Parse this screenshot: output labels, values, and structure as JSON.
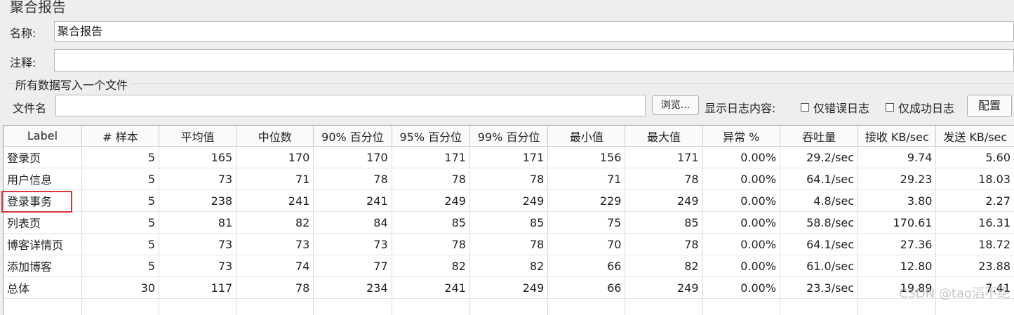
{
  "panel": {
    "title": "聚合报告"
  },
  "name_field": {
    "label": "名称:",
    "value": "聚合报告"
  },
  "comment_field": {
    "label": "注释:",
    "value": ""
  },
  "file_group": {
    "title": "所有数据写入一个文件",
    "file_label": "文件名",
    "file_value": "",
    "browse_label": "浏览...",
    "log_label": "显示日志内容:",
    "errors_only_label": "仅错误日志",
    "success_only_label": "仅成功日志",
    "configure_label": "配置"
  },
  "table": {
    "columns": [
      "Label",
      "# 样本",
      "平均值",
      "中位数",
      "90% 百分位",
      "95% 百分位",
      "99% 百分位",
      "最小值",
      "最大值",
      "异常 %",
      "吞吐量",
      "接收 KB/sec",
      "发送 KB/sec"
    ],
    "rows": [
      [
        "登录页",
        "5",
        "165",
        "170",
        "170",
        "171",
        "171",
        "156",
        "171",
        "0.00%",
        "29.2/sec",
        "9.74",
        "5.60"
      ],
      [
        "用户信息",
        "5",
        "73",
        "71",
        "78",
        "78",
        "78",
        "71",
        "78",
        "0.00%",
        "64.1/sec",
        "29.23",
        "18.03"
      ],
      [
        "登录事务",
        "5",
        "238",
        "241",
        "241",
        "249",
        "249",
        "229",
        "249",
        "0.00%",
        "4.8/sec",
        "3.80",
        "2.27"
      ],
      [
        "列表页",
        "5",
        "81",
        "82",
        "84",
        "85",
        "85",
        "75",
        "85",
        "0.00%",
        "58.8/sec",
        "170.61",
        "16.31"
      ],
      [
        "博客详情页",
        "5",
        "73",
        "73",
        "73",
        "78",
        "78",
        "70",
        "78",
        "0.00%",
        "64.1/sec",
        "27.36",
        "18.72"
      ],
      [
        "添加博客",
        "5",
        "73",
        "74",
        "77",
        "82",
        "82",
        "66",
        "82",
        "0.00%",
        "61.0/sec",
        "12.80",
        "23.88"
      ],
      [
        "总体",
        "30",
        "117",
        "78",
        "234",
        "241",
        "249",
        "66",
        "249",
        "0.00%",
        "23.3/sec",
        "19.89",
        "7.41"
      ]
    ]
  },
  "watermark": "CSDN @tao滔不绝"
}
